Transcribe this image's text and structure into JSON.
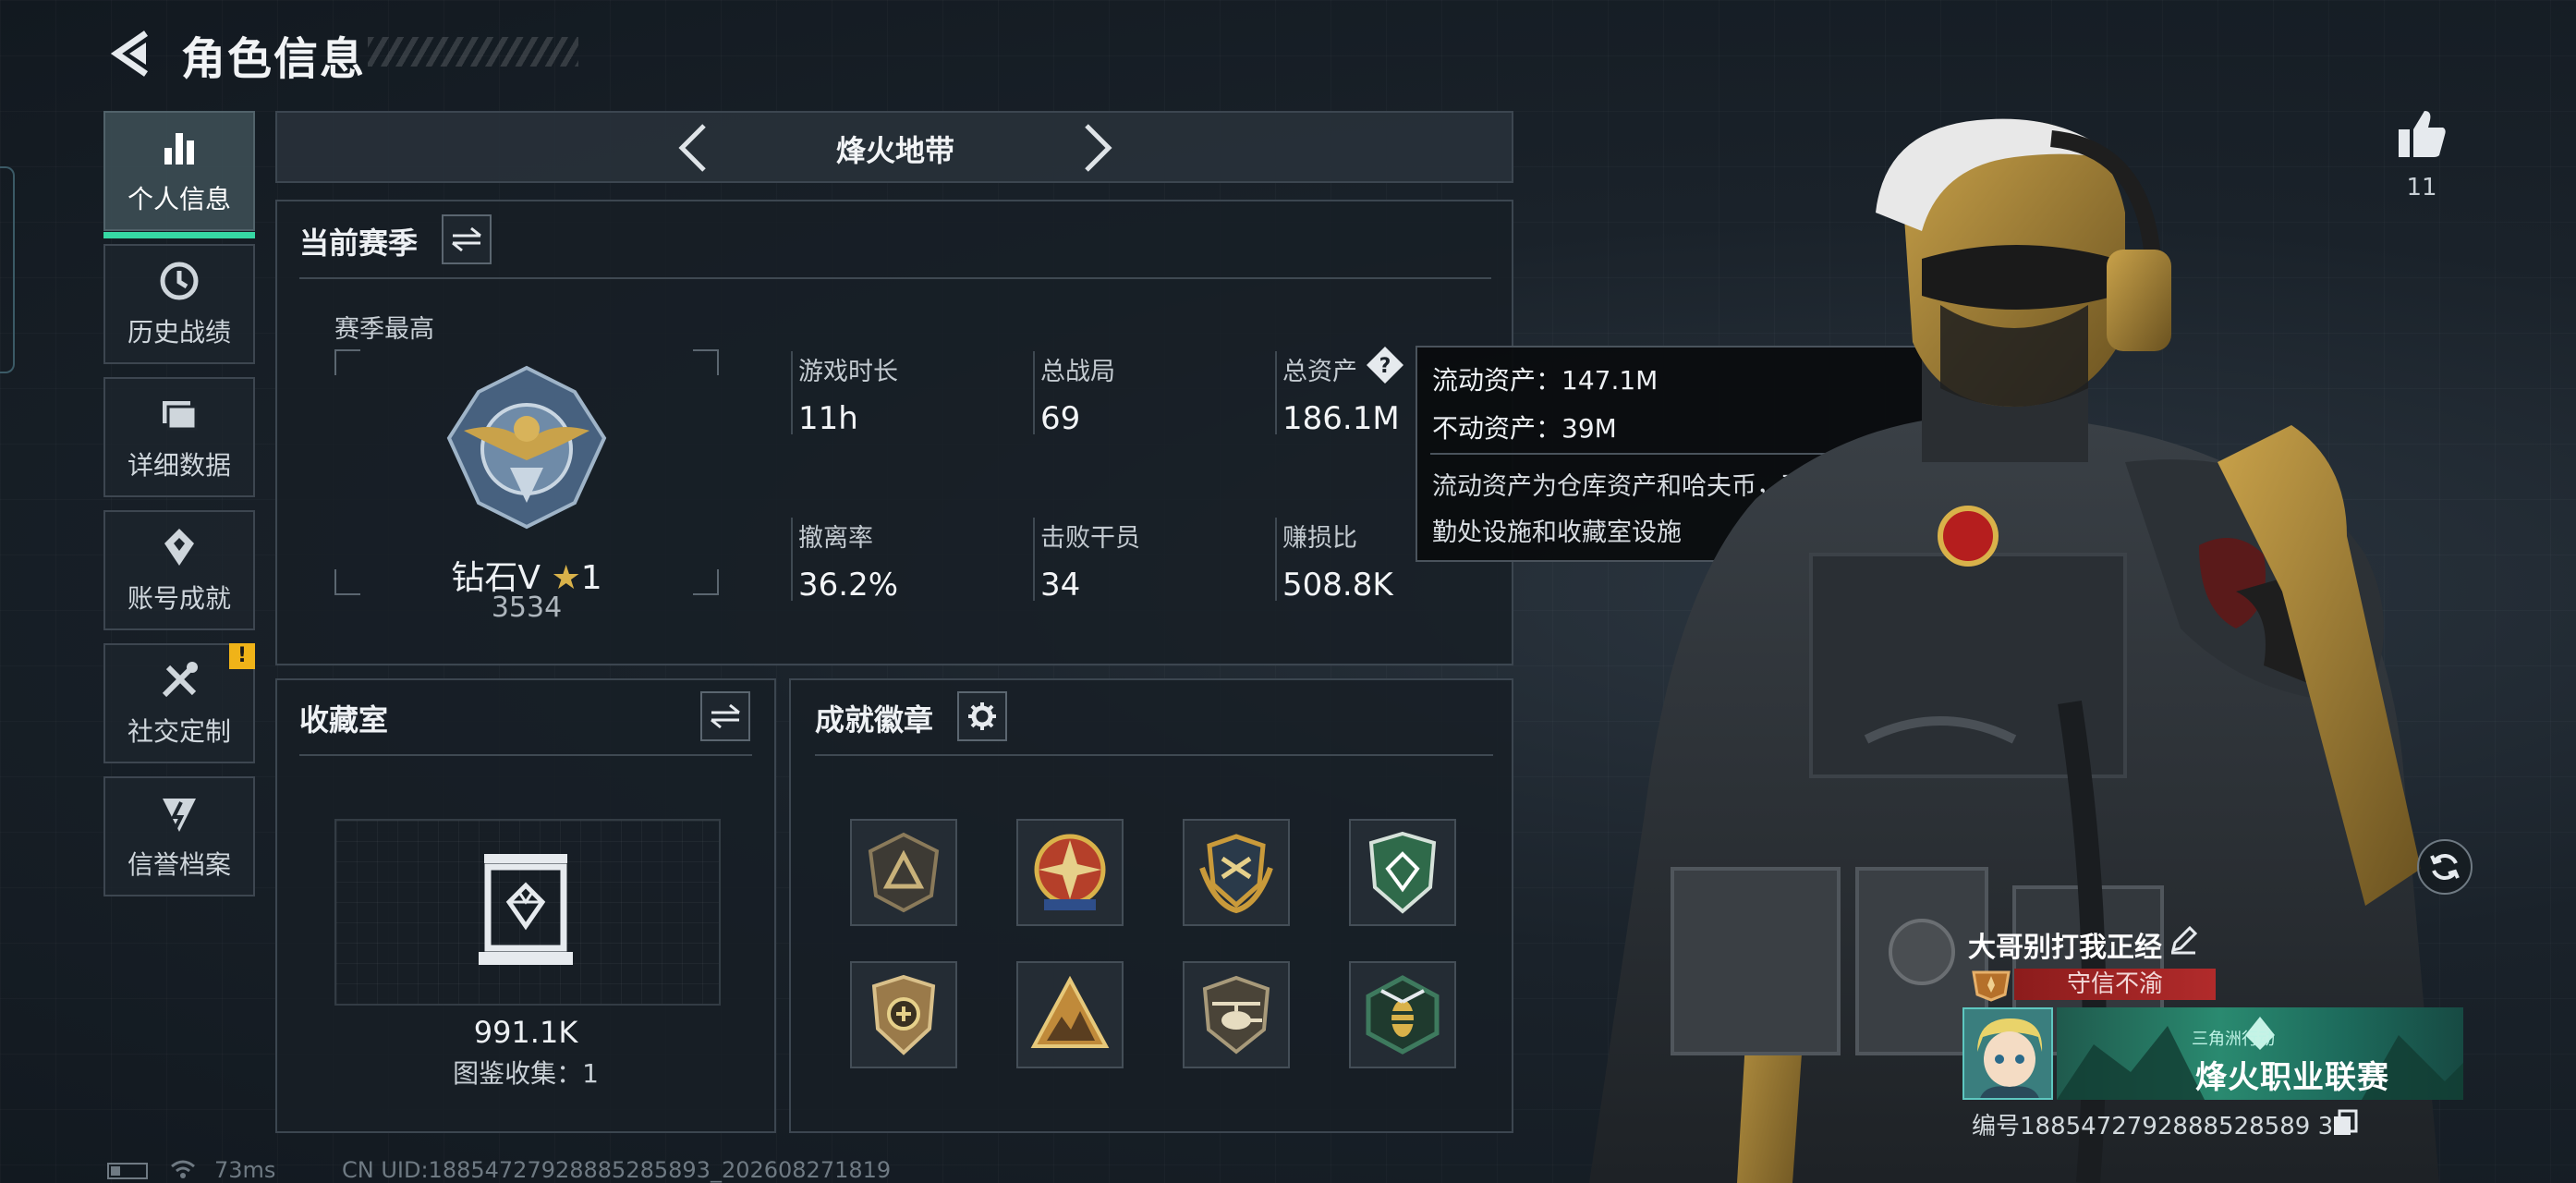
{
  "header": {
    "title": "角色信息"
  },
  "nav": {
    "items": [
      {
        "label": "个人信息",
        "icon": "bar-chart-icon",
        "active": true
      },
      {
        "label": "历史战绩",
        "icon": "history-clock-icon"
      },
      {
        "label": "详细数据",
        "icon": "folder-icon"
      },
      {
        "label": "账号成就",
        "icon": "achievement-icon"
      },
      {
        "label": "社交定制",
        "icon": "tools-icon",
        "badge": "!"
      },
      {
        "label": "信誉档案",
        "icon": "credit-shield-icon"
      }
    ]
  },
  "mode": {
    "title": "烽火地带"
  },
  "season": {
    "title": "当前赛季",
    "best_label": "赛季最高",
    "rank_name": "钻石V",
    "rank_stars": "1",
    "rank_score": "3534",
    "stats": [
      {
        "label": "游戏时长",
        "value": "11h"
      },
      {
        "label": "总战局",
        "value": "69"
      },
      {
        "label": "总资产",
        "value": "186.1M"
      },
      {
        "label": "撤离率",
        "value": "36.2%"
      },
      {
        "label": "击败干员",
        "value": "34"
      },
      {
        "label": "赚损比",
        "value": "508.8K"
      }
    ]
  },
  "tooltip": {
    "liquid": "流动资产：147.1M",
    "fixed": "不动资产：39M",
    "description": "流动资产为仓库资产和哈夫币，不动资产为特勤处设施和收藏室设施"
  },
  "collection": {
    "title": "收藏室",
    "value": "991.1K",
    "count_text": "图鉴收集：1"
  },
  "achievements": {
    "title": "成就徽章",
    "badges": [
      {
        "icon": "triangle-emblem-icon",
        "color": "#8a7a5a"
      },
      {
        "icon": "star-compass-emblem-icon",
        "color": "#b5402a"
      },
      {
        "icon": "wreath-shield-emblem-icon",
        "color": "#c99a3a"
      },
      {
        "icon": "green-shield-emblem-icon",
        "color": "#2f6a4a"
      },
      {
        "icon": "bronze-shield-emblem-icon",
        "color": "#9a7a4a"
      },
      {
        "icon": "mountain-emblem-icon",
        "color": "#c08a3a"
      },
      {
        "icon": "helicopter-emblem-icon",
        "color": "#7a6a4a"
      },
      {
        "icon": "wasp-emblem-icon",
        "color": "#3e7a5e"
      }
    ]
  },
  "status_bar": {
    "ping": "73ms",
    "uid_text": "CN UID:18854727928885285893_202608271819"
  },
  "profile": {
    "likes": "11",
    "player_name": "大哥别打我正经",
    "honor_title": "守信不渝",
    "banner_top": "三角洲行动",
    "banner_main": "烽火职业联赛",
    "id_text": "编号1885472792888528589 3"
  },
  "colors": {
    "accent": "#36d8a4",
    "warning": "#f0b318",
    "honor": "#b12b2b"
  }
}
